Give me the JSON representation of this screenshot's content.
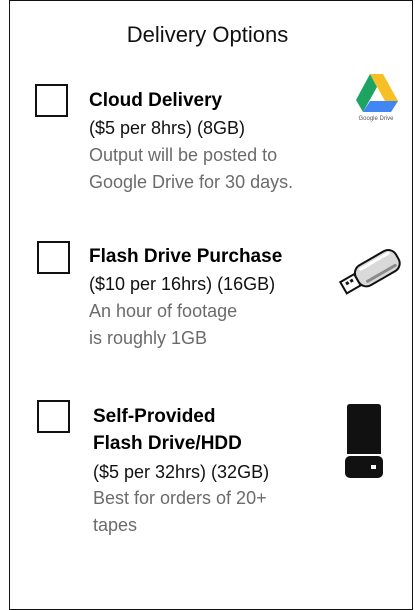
{
  "header": {
    "title": "Delivery Options"
  },
  "options": [
    {
      "title_lines": [
        "Cloud Delivery"
      ],
      "price": "($5 per 8hrs) (8GB)",
      "desc_lines": [
        "Output will be posted to",
        "Google Drive for 30 days."
      ],
      "icon": "google-drive-icon",
      "icon_caption": "Google Drive"
    },
    {
      "title_lines": [
        "Flash Drive Purchase"
      ],
      "price": "($10 per 16hrs) (16GB)",
      "desc_lines": [
        "An hour of footage",
        "is roughly 1GB"
      ],
      "icon": "usb-flash-drive-icon"
    },
    {
      "title_lines": [
        "Self-Provided",
        "Flash Drive/HDD"
      ],
      "price": "($5 per 32hrs) (32GB)",
      "desc_lines": [
        "Best for orders of 20+",
        "tapes"
      ],
      "icon": "hard-drive-icon"
    }
  ],
  "colors": {
    "drive_yellow": "#F6BF26",
    "drive_green": "#1DA362",
    "drive_blue": "#4285F4",
    "desc_gray": "#6b6b6b"
  }
}
